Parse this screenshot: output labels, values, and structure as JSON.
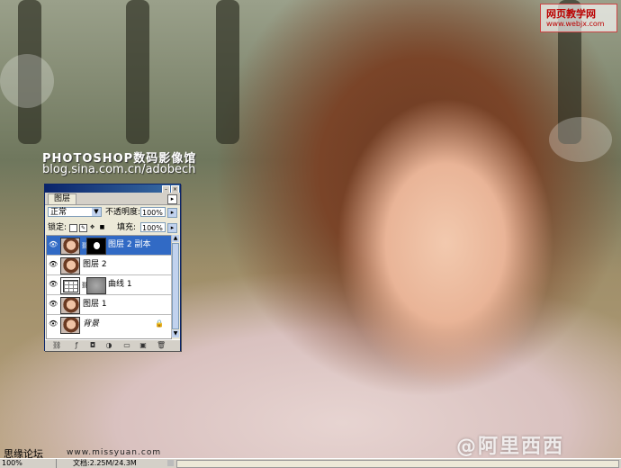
{
  "watermarks": {
    "top_left_title": "PHOTOSHOP数码影像馆",
    "top_left_url": "blog.sina.com.cn/adobech",
    "site_logo_line1": "网页教学网",
    "site_logo_line2": "www.webjx.com",
    "bottom_left": "思缘论坛",
    "bottom_mid": "www.missyuan.com",
    "bottom_right": "@阿里西西"
  },
  "statusbar": {
    "zoom": "100%",
    "doc": "文档:2.25M/24.3M"
  },
  "panel": {
    "tab": "图层",
    "blend_mode": "正常",
    "opacity_label": "不透明度:",
    "opacity_value": "100%",
    "lock_label": "锁定:",
    "fill_label": "填充:",
    "fill_value": "100%",
    "layers": [
      {
        "name": "图层 2 副本",
        "selected": true
      },
      {
        "name": "图层 2"
      },
      {
        "name": "曲线 1"
      },
      {
        "name": "图层 1"
      },
      {
        "name": "背景"
      }
    ]
  }
}
